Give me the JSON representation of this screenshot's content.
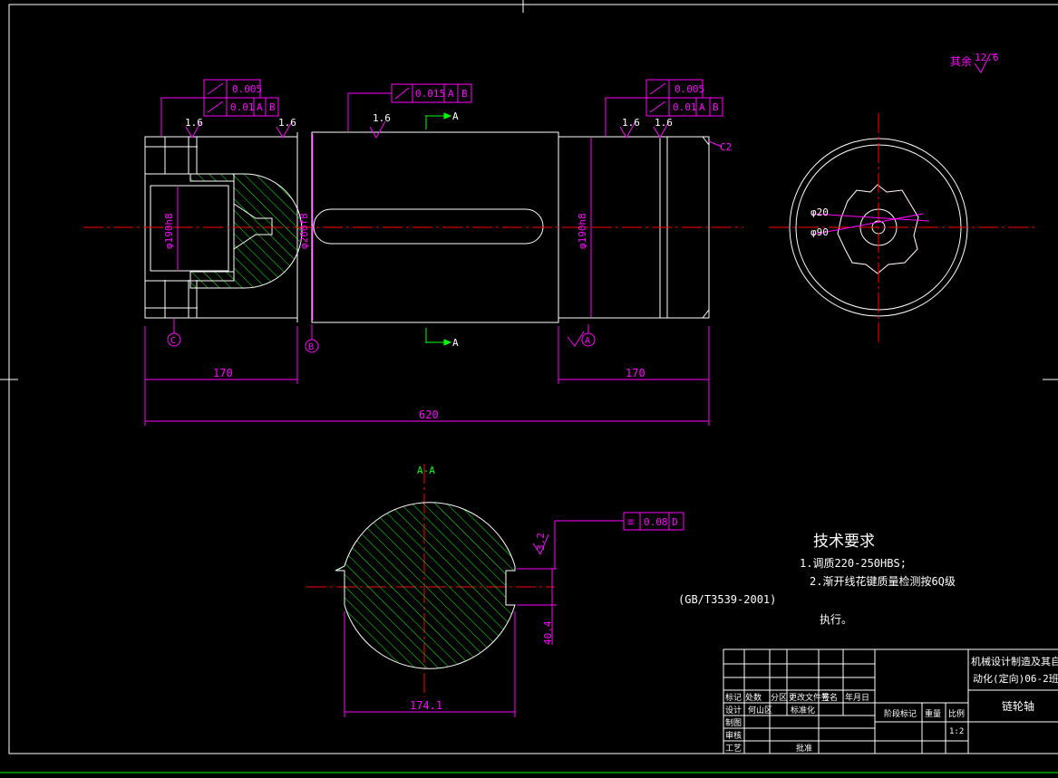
{
  "colors": {
    "background": "#000000",
    "outline": "#ffffff",
    "dimension": "#ff00ff",
    "centerline": "#ff0000",
    "hatch": "#00ff00",
    "view_marker": "#00ff00"
  },
  "roughness": {
    "rest_label": "其余",
    "rest_value": "12.6",
    "r1": "1.6",
    "r2": "1.6",
    "r3": "1.6",
    "r4": "1.6",
    "r5": "1.6",
    "section": "3.2",
    "chamfer_left_low": "C2"
  },
  "tolerances": {
    "left_top": {
      "value": "0.005"
    },
    "left_bottom": {
      "value": "0.01",
      "datum1": "A",
      "datum2": "B"
    },
    "middle": {
      "value": "0.015",
      "datum1": "A",
      "datum2": "B"
    },
    "right_top": {
      "value": "0.005"
    },
    "right_bottom": {
      "value": "0.01",
      "datum1": "A",
      "datum2": "B"
    },
    "section": {
      "symbol": "≡",
      "value": "0.08",
      "datum": "D"
    }
  },
  "dimensions": {
    "d_left": "φ190h8",
    "d_center": "φ200f8",
    "d_right": "φ190h8",
    "len_left": "170",
    "len_right": "170",
    "len_total": "620",
    "chamfer": "C2",
    "d20": "φ20",
    "d90": "φ90",
    "keyway_depth": "40.4",
    "keyway_width": "174.1"
  },
  "datums": {
    "c": "C",
    "b": "B",
    "a": "A"
  },
  "section_marks": {
    "arrow": "A",
    "title": "A-A"
  },
  "requirements": {
    "title": "技术要求",
    "line1": "1.调质220-250HBS;",
    "line2": "2.渐开线花键质量检测按6Q级",
    "standard": "(GB/T3539-2001)",
    "line3": "执行。"
  },
  "title_block": {
    "design_line1": "机械设计制造及其自",
    "design_line2": "动化(定向)06-2班",
    "part_name": "链轮轴",
    "labels": {
      "mark": "标记",
      "count": "处数",
      "zone": "分区",
      "doc": "更改文件号",
      "sign": "签名",
      "date": "年月日",
      "designer": "设计",
      "designer_name": "何山区",
      "std": "标准化",
      "check": "制图",
      "review": "审核",
      "process": "工艺",
      "approve": "批准",
      "stage": "阶段标记",
      "weight": "重量",
      "scale": "比例",
      "scale_value": "1:2"
    }
  }
}
